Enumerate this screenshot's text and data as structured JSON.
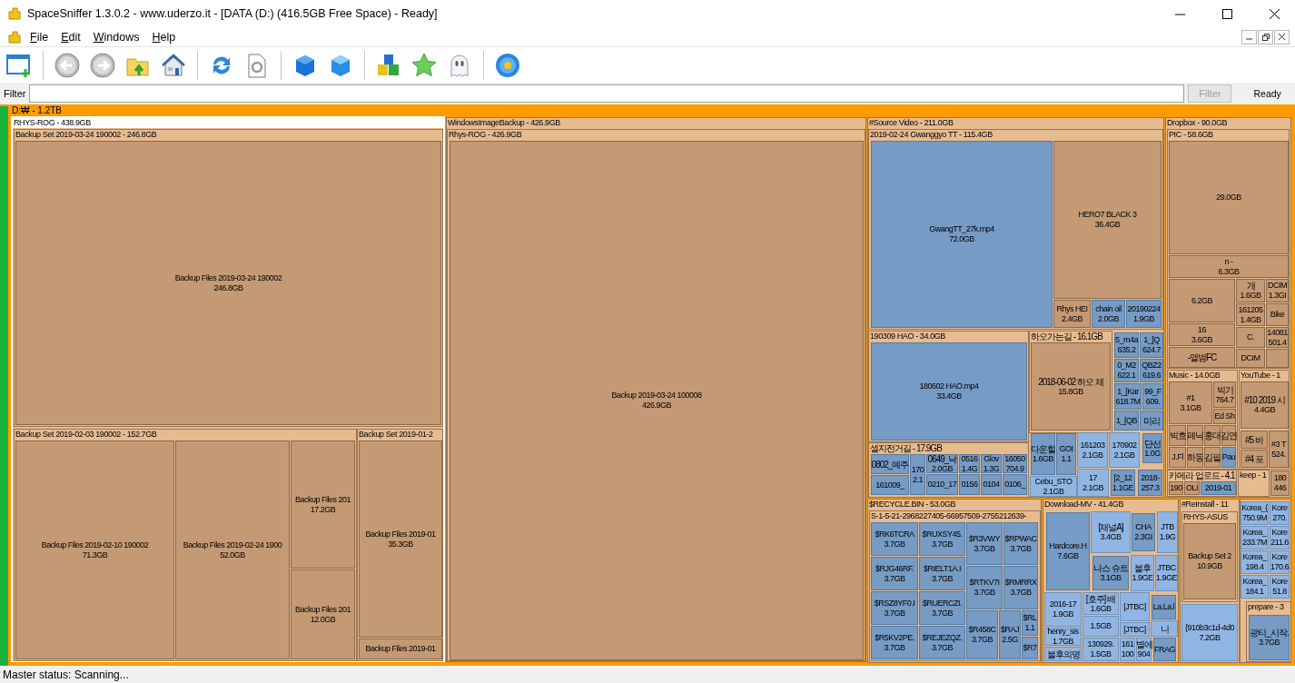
{
  "window": {
    "title": "SpaceSniffer 1.3.0.2 - www.uderzo.it - [DATA (D:) (416.5GB Free Space) - Ready]"
  },
  "menu": [
    {
      "label": "File"
    },
    {
      "label": "Edit"
    },
    {
      "label": "Windows"
    },
    {
      "label": "Help"
    }
  ],
  "filter": {
    "label": "Filter",
    "button": {
      "label": "Filter",
      "disabled": true
    },
    "status": "Ready"
  },
  "treemap": {
    "label": "D:₩ - 1.2TB",
    "children": [
      {
        "kind": "folder",
        "label": "RHYS-ROG - 438.9GB",
        "selected": true,
        "children": [
          {
            "kind": "folder",
            "label": "Backup Set 2019-03-24 190002 - 246.8GB",
            "children": [
              {
                "kind": "block",
                "name": "Backup Files 2019-03-24 190002",
                "size": "246.8GB"
              }
            ]
          },
          {
            "kind": "folder",
            "label": "Backup Set 2019-02-03 190002 - 152.7GB",
            "children": [
              {
                "kind": "block",
                "name": "Backup Files 2019-02-10 190002",
                "size": "71.3GB"
              },
              {
                "kind": "block",
                "name": "Backup Files 2019-02-24 1900",
                "size": "52.0GB"
              },
              {
                "kind": "block",
                "name": "Backup Files 201",
                "size": "17.2GB"
              },
              {
                "kind": "block",
                "name": "Backup Files 201",
                "size": "12.0GB"
              }
            ]
          },
          {
            "kind": "folder",
            "label": "Backup Set 2019-01-2",
            "children": [
              {
                "kind": "block",
                "name": "Backup Files 2019-01",
                "size": "35.3GB"
              },
              {
                "kind": "block",
                "name": "Backup Files 2019-01"
              }
            ]
          }
        ]
      },
      {
        "kind": "folder",
        "label": "WindowsImageBackup - 426.9GB",
        "selected": false,
        "children": [
          {
            "kind": "folder",
            "label": "Rhys-ROG - 426.9GB",
            "children": [
              {
                "kind": "block",
                "name": "Backup 2019-03-24 100008",
                "size": "426.9GB"
              }
            ]
          }
        ]
      },
      {
        "kind": "folder",
        "label": "#Source Video - 211.0GB",
        "selected": false,
        "children": [
          {
            "kind": "folder",
            "label": "2019-02-24 Gwanggyo TT - 115.4GB",
            "children": [
              {
                "kind": "file",
                "name": "GwangTT_27k.mp4",
                "size": "72.0GB"
              },
              {
                "kind": "block",
                "name": "HERO7 BLACK 3",
                "size": "36.4GB"
              },
              {
                "kind": "block",
                "name": "Rhys HEI",
                "size": "2.4GB"
              },
              {
                "kind": "file",
                "name": "chain oil",
                "size": "2.0GB"
              },
              {
                "kind": "file",
                "name": "20190224",
                "size": "1.9GB"
              }
            ]
          },
          {
            "kind": "folder",
            "label": "190309 HAO - 34.0GB",
            "children": [
              {
                "kind": "file",
                "name": "180602 HAO.mp4",
                "size": "33.4GB"
              }
            ]
          },
          {
            "kind": "folder",
            "label": "하오가는길 - 16.1GB",
            "children": [
              {
                "kind": "block",
                "name": "2018-06-02 하오 체",
                "size": "15.8GB"
              }
            ]
          },
          {
            "kind": "file",
            "name": "5_m4a",
            "size": "635.2"
          },
          {
            "kind": "file",
            "name": "1_[Q",
            "size": "624.7"
          },
          {
            "kind": "file",
            "name": "0_M2",
            "size": "622.1"
          },
          {
            "kind": "file",
            "name": "QBZ2",
            "size": "619.6"
          },
          {
            "kind": "file",
            "name": "1_[Kar",
            "size": "618.7M"
          },
          {
            "kind": "file",
            "name": "99_F",
            "size": "609."
          },
          {
            "kind": "file",
            "name": "1_[QB"
          },
          {
            "kind": "file",
            "name": "미리"
          },
          {
            "kind": "folder",
            "label": "셀지전거길 - 17.9GB",
            "children": [
              {
                "kind": "file",
                "name": "0802_예주"
              },
              {
                "kind": "file",
                "name": "161009_"
              },
              {
                "kind": "file",
                "name": "170",
                "size": "2.1"
              },
              {
                "kind": "file",
                "name": "0649_낙",
                "size": "2.0GB"
              },
              {
                "kind": "file",
                "name": "0210_17"
              },
              {
                "kind": "file",
                "name": "0516",
                "size": "1.4G"
              },
              {
                "kind": "file",
                "name": "0156"
              },
              {
                "kind": "file",
                "name": "Glov",
                "size": "1.3G"
              },
              {
                "kind": "file",
                "name": "0104"
              },
              {
                "kind": "file",
                "name": "16050",
                "size": "704.9"
              },
              {
                "kind": "file",
                "name": "0106_"
              }
            ]
          },
          {
            "kind": "file",
            "name": "다운힐",
            "size": "1.6GB"
          },
          {
            "kind": "file",
            "name": "GOI",
            "size": "1.1"
          },
          {
            "kind": "file-light",
            "name": "Cebu_STO",
            "size": "2.1GB"
          },
          {
            "kind": "file-light",
            "name": "161203",
            "size": "2.1GB"
          },
          {
            "kind": "file-light",
            "name": "170902",
            "size": "2.1GB"
          },
          {
            "kind": "file",
            "name": "단선",
            "size": "1.0G"
          },
          {
            "kind": "file-light",
            "name": "17",
            "size": "2.1GB"
          },
          {
            "kind": "file",
            "name": "[2_12",
            "size": "1.1GE"
          },
          {
            "kind": "file",
            "name": "2018-",
            "size": "257.3"
          }
        ]
      },
      {
        "kind": "folder",
        "label": "Dropbox - 90.0GB",
        "selected": false,
        "children": [
          {
            "kind": "folder",
            "label": "PIC - 58.6GB",
            "children": [
              {
                "kind": "block",
                "size": "29.0GB"
              },
              {
                "kind": "block",
                "name": "n -",
                "size": "6.3GB"
              },
              {
                "kind": "block",
                "size": "6.2GB"
              },
              {
                "kind": "block",
                "name": "16",
                "size": "3.6GB"
              },
              {
                "kind": "block",
                "name": "-앨범FC"
              },
              {
                "kind": "block",
                "name": "개",
                "size": "1.6GB"
              },
              {
                "kind": "block",
                "name": "DCIM",
                "size": "1.3GI"
              },
              {
                "kind": "block",
                "name": "161205",
                "size": "1.4GB"
              },
              {
                "kind": "block",
                "name": "Bike"
              },
              {
                "kind": "block",
                "name": "C."
              },
              {
                "kind": "block",
                "name": "14081",
                "size": "501.4"
              },
              {
                "kind": "block",
                "name": "DCIM"
              },
              {
                "kind": "block"
              }
            ]
          },
          {
            "kind": "folder",
            "label": "Music - 14.0GB",
            "children": [
              {
                "kind": "block",
                "name": "#1",
                "size": "3.1GB"
              },
              {
                "kind": "block",
                "name": "빅기",
                "size": "764.7"
              },
              {
                "kind": "block",
                "name": "Ed Sh"
              },
              {
                "kind": "block",
                "name": "빅효"
              },
              {
                "kind": "block",
                "name": "페닉"
              },
              {
                "kind": "block",
                "name": "홍대"
              },
              {
                "kind": "block",
                "name": "김연"
              },
              {
                "kind": "block",
                "name": "J.Fl"
              },
              {
                "kind": "block",
                "name": "하동"
              },
              {
                "kind": "block",
                "name": "김필"
              },
              {
                "kind": "file",
                "name": "Pau"
              }
            ]
          },
          {
            "kind": "folder",
            "label": "YouTube - 1",
            "children": [
              {
                "kind": "block",
                "name": "#10 2019 시",
                "size": "4.4GB"
              },
              {
                "kind": "block",
                "name": "#5 바"
              },
              {
                "kind": "block",
                "name": "#4 포"
              },
              {
                "kind": "block",
                "name": "#3 T",
                "size": "524."
              }
            ]
          },
          {
            "kind": "folder",
            "label": "카메라 업로드 - 4.1",
            "children": [
              {
                "kind": "block",
                "name": "190"
              },
              {
                "kind": "block",
                "name": "OLI"
              },
              {
                "kind": "file",
                "name": "2019-01"
              }
            ]
          },
          {
            "kind": "folder",
            "label": "keep - 1"
          },
          {
            "kind": "block",
            "name": "180",
            "size": "446"
          }
        ]
      },
      {
        "kind": "folder",
        "label": "$RECYCLE.BIN - 53.0GB",
        "selected": false,
        "children": [
          {
            "kind": "folder",
            "label": "S-1-5-21-2968227405-66957509-2755212639-",
            "children": [
              {
                "kind": "file",
                "name": "$RK6TCRA",
                "size": "3.7GB"
              },
              {
                "kind": "file",
                "name": "$RUXSY45.",
                "size": "3.7GB"
              },
              {
                "kind": "file",
                "name": "$RJG46RF.",
                "size": "3.7GB"
              },
              {
                "kind": "file",
                "name": "$RIELT1A.I",
                "size": "3.7GB"
              },
              {
                "kind": "file",
                "name": "$RSZ8YF0.I",
                "size": "3.7GB"
              },
              {
                "kind": "file",
                "name": "$RUERCZI.",
                "size": "3.7GB"
              },
              {
                "kind": "file",
                "name": "$R5KV2PE.",
                "size": "3.7GB"
              },
              {
                "kind": "file",
                "name": "$REJEZQZ.",
                "size": "3.7GB"
              },
              {
                "kind": "file",
                "name": "$R3VWY",
                "size": "3.7GB"
              },
              {
                "kind": "file",
                "name": "$RPWAC",
                "size": "3.7GB"
              },
              {
                "kind": "file",
                "name": "$RTKV7I",
                "size": "3.7GB"
              },
              {
                "kind": "file",
                "name": "$RMRRX",
                "size": "3.7GB"
              },
              {
                "kind": "file",
                "name": "$R458C",
                "size": "3.7GB"
              },
              {
                "kind": "file",
                "name": "$RAJ",
                "size": "2.5G"
              },
              {
                "kind": "file",
                "name": "$RL",
                "size": "1.1"
              },
              {
                "kind": "file",
                "name": "$R7"
              }
            ]
          }
        ]
      },
      {
        "kind": "folder",
        "label": "Download-MV - 41.4GB",
        "selected": false,
        "children": [
          {
            "kind": "file",
            "name": "Hardcore.H",
            "size": "7.6GB"
          },
          {
            "kind": "file-light",
            "name": "[채널A]",
            "size": "3.4GB"
          },
          {
            "kind": "file",
            "name": "CHA",
            "size": "2.3GI"
          },
          {
            "kind": "file-light",
            "name": "JTB",
            "size": "1.9G"
          },
          {
            "kind": "file",
            "name": "나스 슈트",
            "size": "3.1GB"
          },
          {
            "kind": "file-light",
            "name": "불후",
            "size": "1.9GE"
          },
          {
            "kind": "file-light",
            "name": "JTBC",
            "size": "1.9GE"
          },
          {
            "kind": "file-light",
            "name": "2016-17",
            "size": "1.9GB"
          },
          {
            "kind": "file-light",
            "name": "[호주] 배",
            "size": "1.6GB"
          },
          {
            "kind": "file-light",
            "name": "[JTBC]"
          },
          {
            "kind": "file",
            "name": "La.La.l"
          },
          {
            "kind": "file-light",
            "name": "henry_sis",
            "size": "1.7GB"
          },
          {
            "kind": "file-light",
            "size": "1.5GB"
          },
          {
            "kind": "file-light",
            "name": "[JTBC]"
          },
          {
            "kind": "file-light",
            "name": "니"
          },
          {
            "kind": "file-light",
            "name": "불후의명"
          },
          {
            "kind": "file-light",
            "name": "130929.",
            "size": "1.5GB"
          },
          {
            "kind": "file-light",
            "name": "161",
            "size": "100"
          },
          {
            "kind": "file-light",
            "name": "별에",
            "size": "904"
          },
          {
            "kind": "file",
            "name": "FRAG"
          }
        ]
      },
      {
        "kind": "folder",
        "label": "#ReInstall - 11",
        "selected": false,
        "children": [
          {
            "kind": "folder",
            "label": "RHYS-ASUS",
            "children": [
              {
                "kind": "block",
                "name": "Backup Set 2",
                "size": "10.9GB"
              }
            ]
          },
          {
            "kind": "file-light",
            "name": "{910b3c1d-4d0",
            "size": "7.2GB"
          }
        ]
      },
      {
        "kind": "folder",
        "selected": false,
        "children": [
          {
            "kind": "file-light",
            "name": "Korea_(",
            "size": "750.9M"
          },
          {
            "kind": "file-light",
            "name": "Kore",
            "size": "270."
          },
          {
            "kind": "file-light",
            "name": "Korea_",
            "size": "233.7M"
          },
          {
            "kind": "file-light",
            "name": "Kore",
            "size": "211.6"
          },
          {
            "kind": "file-light",
            "name": "Korea_",
            "size": "198.4"
          },
          {
            "kind": "file-light",
            "name": "Kore",
            "size": "170.6"
          },
          {
            "kind": "file-light",
            "name": "Korea_",
            "size": "184.1"
          },
          {
            "kind": "file-light",
            "name": "Kore",
            "size": "51.8"
          },
          {
            "kind": "folder",
            "label": "prepare - 3",
            "children": [
              {
                "kind": "file",
                "name": "광티_시작.",
                "size": "3.7GB"
              }
            ]
          }
        ]
      }
    ]
  },
  "status_bar": "Master status: Scanning..."
}
